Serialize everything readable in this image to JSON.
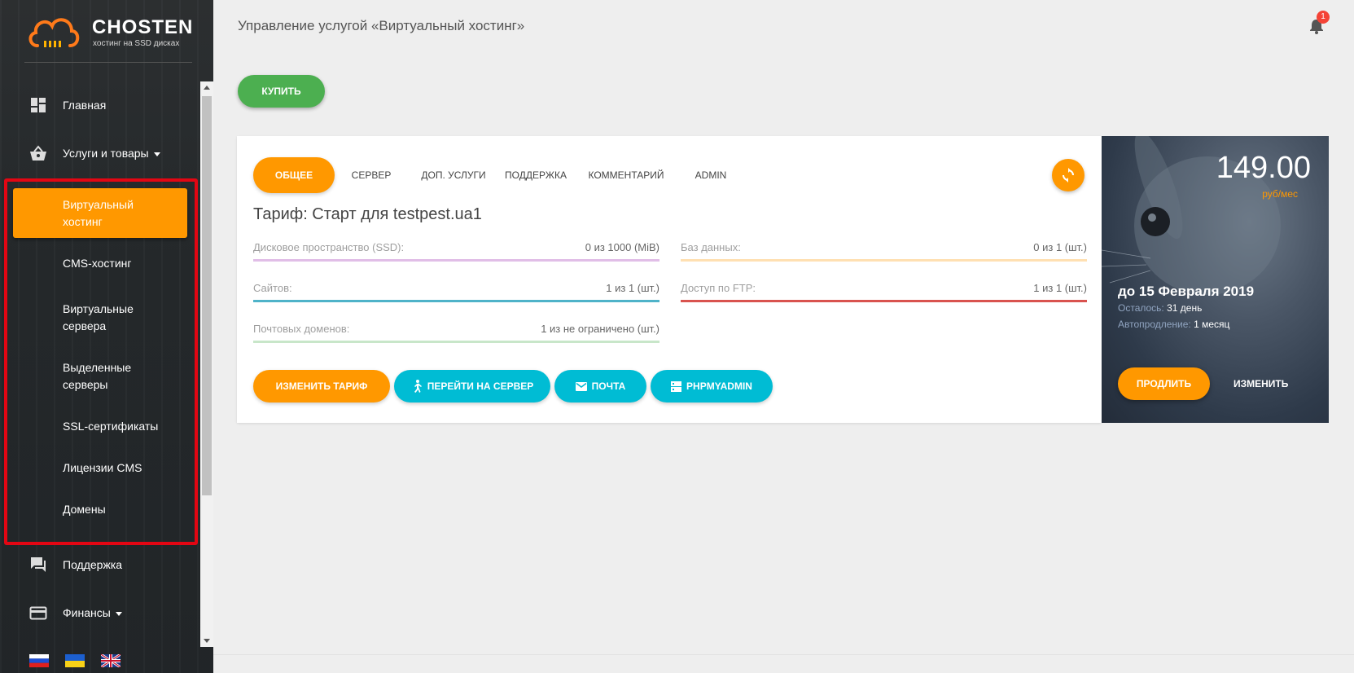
{
  "brand": {
    "title": "CHOSTEN",
    "subtitle": "хостинг на SSD дисках"
  },
  "sidebar": {
    "items": [
      {
        "label": "Главная",
        "icon": "dashboard-icon"
      },
      {
        "label": "Услуги и товары",
        "icon": "basket-icon",
        "has_caret": true
      },
      {
        "label": "Поддержка",
        "icon": "chat-icon"
      },
      {
        "label": "Финансы",
        "icon": "card-icon",
        "has_caret": true
      }
    ],
    "services": [
      {
        "label": "Виртуальный хостинг",
        "active": true
      },
      {
        "label": "CMS-хостинг"
      },
      {
        "label": "Виртуальные сервера"
      },
      {
        "label": "Выделенные серверы"
      },
      {
        "label": "SSL-сертификаты"
      },
      {
        "label": "Лицензии CMS"
      },
      {
        "label": "Домены"
      }
    ],
    "languages": [
      "ru",
      "ua",
      "en"
    ]
  },
  "header": {
    "title": "Управление услугой «Виртуальный хостинг»",
    "notifications_count": "1"
  },
  "buy_label": "КУПИТЬ",
  "tabs": [
    "ОБЩЕЕ",
    "СЕРВЕР",
    "ДОП. УСЛУГИ",
    "ПОДДЕРЖКА",
    "КОММЕНТАРИЙ",
    "ADMIN"
  ],
  "tariff": {
    "title": "Тариф: Старт для testpest.ua1"
  },
  "stats": [
    {
      "label": "Дисковое пространство (SSD):",
      "value": "0 из 1000 (MiB)",
      "color": "#e1bee7"
    },
    {
      "label": "Баз данных:",
      "value": "0 из 1 (шт.)",
      "color": "#ffe0b2"
    },
    {
      "label": "Сайтов:",
      "value": "1 из 1 (шт.)",
      "color": "#4fb3c9"
    },
    {
      "label": "Доступ по FTP:",
      "value": "1 из 1 (шт.)",
      "color": "#d9534f"
    },
    {
      "label": "Почтовых доменов:",
      "value": "1 из не ограничено (шт.)",
      "color": "#c8e6c9"
    }
  ],
  "actions": {
    "change_tariff": "ИЗМЕНИТЬ ТАРИФ",
    "goto_server": "ПЕРЕЙТИ НА СЕРВЕР",
    "mail": "ПОЧТА",
    "phpmyadmin": "PHPMYADMIN"
  },
  "billing": {
    "price": "149.00",
    "unit": "руб/мес",
    "until": "до 15 Февраля 2019",
    "remaining_label": "Осталось:",
    "remaining_value": "31 день",
    "autorenew_label": "Автопродление:",
    "autorenew_value": "1 месяц",
    "prolong_label": "ПРОДЛИТЬ",
    "change_label": "ИЗМЕНИТЬ"
  },
  "colors": {
    "accent": "#ff9800",
    "buy": "#4caf50",
    "secondary": "#00bcd4",
    "highlight": "#e30613"
  }
}
